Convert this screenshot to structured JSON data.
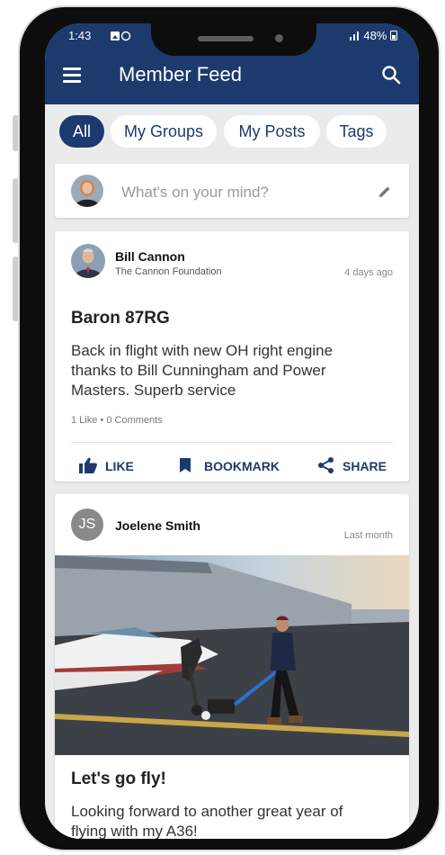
{
  "status": {
    "time": "1:43",
    "battery": "48%"
  },
  "header": {
    "title": "Member Feed"
  },
  "tabs": [
    "All",
    "My Groups",
    "My Posts",
    "Tags"
  ],
  "composer": {
    "placeholder": "What's on your mind?"
  },
  "posts": [
    {
      "author": "Bill Cannon",
      "org": "The Cannon Foundation",
      "time": "4 days ago",
      "title": "Baron 87RG",
      "body": "Back in flight with new OH right engine thanks to Bill Cunningham and Power Masters. Superb service",
      "likes": "1 Like",
      "comments": "0 Comments",
      "actions": {
        "like": "LIKE",
        "bookmark": "BOOKMARK",
        "share": "SHARE"
      }
    },
    {
      "author": "Joelene Smith",
      "initials": "JS",
      "time": "Last month",
      "title": "Let's go fly!",
      "body": "Looking forward to another great year of flying with my A36!"
    }
  ],
  "colors": {
    "brand": "#1d3a6e",
    "background": "#ebebeb"
  }
}
